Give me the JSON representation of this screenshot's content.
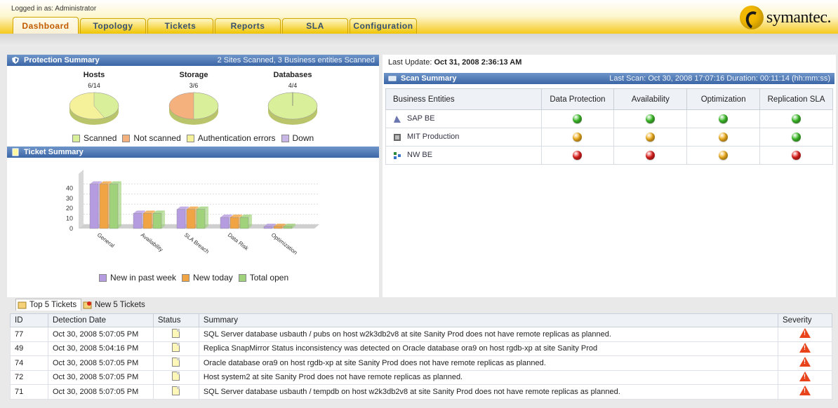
{
  "login_text": "Logged in as: Administrator",
  "brand": "symantec.",
  "tabs": [
    "Dashboard",
    "Topology",
    "Tickets",
    "Reports",
    "SLA",
    "Configuration"
  ],
  "protection": {
    "title": "Protection Summary",
    "right": "2 Sites Scanned, 3 Business entities Scanned",
    "pies": [
      {
        "title": "Hosts",
        "count": "6/14",
        "scanned_fraction": 0.43
      },
      {
        "title": "Storage",
        "count": "3/6",
        "scanned_fraction": 0.5
      },
      {
        "title": "Databases",
        "count": "4/4",
        "scanned_fraction": 1.0
      }
    ],
    "legend": [
      {
        "label": "Scanned",
        "color": "#d9ef9a"
      },
      {
        "label": "Not scanned",
        "color": "#f4b07d"
      },
      {
        "label": "Authentication errors",
        "color": "#f5f09a"
      },
      {
        "label": "Down",
        "color": "#c7b6e6"
      }
    ]
  },
  "ticket_summary": {
    "title": "Ticket Summary"
  },
  "chart_data": {
    "type": "bar",
    "categories": [
      "General",
      "Availability",
      "SLA Breach",
      "Data Risk",
      "Optimization"
    ],
    "series": [
      {
        "name": "New in past week",
        "values": [
          44,
          15,
          19,
          11,
          2
        ],
        "color": "#b59be0"
      },
      {
        "name": "New today",
        "values": [
          44,
          15,
          19,
          11,
          2
        ],
        "color": "#f0a443"
      },
      {
        "name": "Total open",
        "values": [
          44,
          15,
          19,
          11,
          2
        ],
        "color": "#9fd27a"
      }
    ],
    "yticks": [
      "0",
      "10",
      "20",
      "30",
      "40"
    ],
    "ylim": [
      0,
      50
    ],
    "grid": true
  },
  "scan": {
    "last_update_label": "Last Update:",
    "last_update_value": "Oct 31, 2008 2:36:13 AM",
    "title": "Scan Summary",
    "right": "Last Scan: Oct 30, 2008 17:07:16 Duration: 00:11:14 (hh:mm:ss)",
    "columns": [
      "Business Entities",
      "Data Protection",
      "Availability",
      "Optimization",
      "Replication SLA"
    ],
    "rows": [
      {
        "name": "SAP BE",
        "icon": "sap-be-icon",
        "status": [
          "green",
          "green",
          "green",
          "green"
        ]
      },
      {
        "name": "MIT Production",
        "icon": "mit-production-icon",
        "status": [
          "yellow",
          "yellow",
          "yellow",
          "green"
        ]
      },
      {
        "name": "NW BE",
        "icon": "nw-be-icon",
        "status": [
          "red",
          "red",
          "yellow",
          "red"
        ]
      }
    ],
    "colors": {
      "green": "#3fbe2b",
      "yellow": "#f2b01d",
      "red": "#e0211e"
    }
  },
  "bottom": {
    "tabs": [
      "Top 5 Tickets",
      "New 5 Tickets"
    ],
    "columns": [
      "ID",
      "Detection Date",
      "Status",
      "Summary",
      "Severity"
    ],
    "rows": [
      {
        "id": "77",
        "date": "Oct 30, 2008 5:07:05 PM",
        "summary": "SQL Server database usbauth / pubs on host w2k3db2v8 at site Sanity Prod does not have remote replicas as planned."
      },
      {
        "id": "49",
        "date": "Oct 30, 2008 5:04:16 PM",
        "summary": "Replica SnapMirror Status inconsistency was detected on Oracle database ora9 on host rgdb-xp at site Sanity Prod"
      },
      {
        "id": "74",
        "date": "Oct 30, 2008 5:07:05 PM",
        "summary": "Oracle database ora9 on host rgdb-xp at site Sanity Prod does not have remote replicas as planned."
      },
      {
        "id": "72",
        "date": "Oct 30, 2008 5:07:05 PM",
        "summary": "Host system2 at site Sanity Prod does not have remote replicas as planned."
      },
      {
        "id": "71",
        "date": "Oct 30, 2008 5:07:05 PM",
        "summary": "SQL Server database usbauth / tempdb on host w2k3db2v8 at site Sanity Prod does not have remote replicas as planned."
      }
    ]
  }
}
